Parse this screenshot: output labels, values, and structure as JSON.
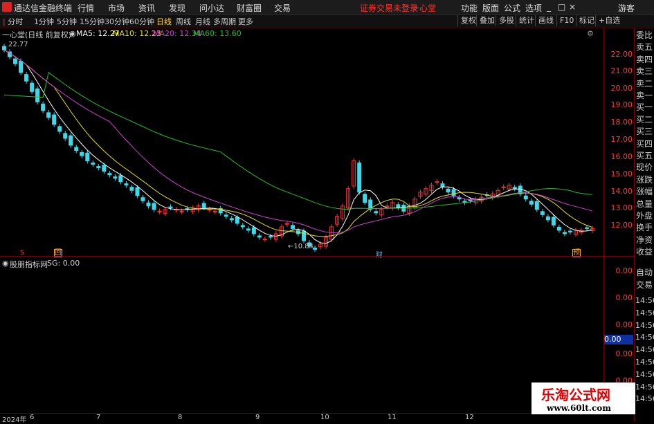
{
  "app": {
    "title": "通达信金融终端"
  },
  "menu": [
    "行情",
    "市场",
    "资讯",
    "发现",
    "问小达",
    "财富圈",
    "交易"
  ],
  "status": {
    "warning": "证券交易未登录",
    "stock_name": "一心堂"
  },
  "right_menu": [
    "功能",
    "版面",
    "公式",
    "选项"
  ],
  "user": "游客",
  "periods": [
    "分时",
    "1分钟",
    "5分钟",
    "15分钟",
    "30分钟",
    "60分钟",
    "日线",
    "周线",
    "月线",
    "多周期",
    "更多"
  ],
  "active_period": "日线",
  "tools": [
    "复权",
    "叠加",
    "多股",
    "统计",
    "画线",
    "F10",
    "标记",
    "+自选"
  ],
  "main_legend": {
    "title": "一心堂(日线 前复权)",
    "ma5": "MA5: 12.27",
    "ma10": "MA10: 12.23",
    "ma20": "MA20: 12.34",
    "ma60": "MA60: 13.60"
  },
  "colors": {
    "ma5": "#ffffff",
    "ma10": "#e8e000",
    "ma20": "#d040d0",
    "ma60": "#20c020",
    "up": "#ff3030",
    "down": "#40d8e8"
  },
  "y_ticks": [
    "22.00",
    "21.00",
    "20.00",
    "19.00",
    "18.00",
    "17.00",
    "16.00",
    "15.00",
    "14.00",
    "13.00",
    "12.00"
  ],
  "annotations": {
    "high": "22.77",
    "low": "←10.84",
    "cai": "财",
    "yu": "预",
    "s": "S",
    "hui": "回"
  },
  "indicator": {
    "name": "股朋指标网",
    "sg": "SG: 0.00"
  },
  "y2_ticks": [
    "0.00",
    "0.00",
    "0.00",
    "0.00",
    "0.00"
  ],
  "y2_box": "0.00",
  "x_ticks": [
    "2024年",
    "6",
    "7",
    "8",
    "9",
    "10",
    "11",
    "12"
  ],
  "right_panel": [
    "委比",
    "卖五",
    "卖四",
    "卖三",
    "卖二",
    "卖一",
    "买一",
    "买二",
    "买三",
    "买四",
    "买五",
    "现价",
    "涨跌",
    "涨幅",
    "总量",
    "外盘",
    "换手",
    "净资",
    "收益"
  ],
  "right_panel2": [
    "自动",
    "交易"
  ],
  "times": [
    "14:56",
    "14:56",
    "14:56",
    "14:56",
    "14:56",
    "14:56",
    "14:56",
    "14:56",
    "14:56"
  ],
  "watermark": {
    "line1": "乐淘公式网",
    "line2": "www.60lt.com"
  },
  "chart_data": {
    "type": "candlestick",
    "ylim": [
      11.2,
      23.4
    ],
    "close": [
      22.6,
      22.2,
      21.8,
      21.3,
      20.8,
      20.2,
      19.6,
      19.1,
      18.7,
      18.3,
      17.9,
      17.5,
      17.1,
      16.8,
      16.5,
      16.2,
      16.0,
      15.8,
      15.6,
      15.4,
      15.2,
      15.0,
      14.8,
      14.5,
      14.2,
      13.9,
      13.6,
      13.4,
      13.3,
      13.4,
      13.5,
      13.4,
      13.3,
      13.4,
      13.5,
      13.6,
      13.5,
      13.4,
      13.3,
      13.2,
      13.0,
      12.8,
      12.6,
      12.4,
      12.2,
      12.0,
      11.8,
      11.7,
      11.8,
      12.0,
      12.4,
      12.6,
      12.3,
      12.0,
      11.6,
      11.3,
      11.1,
      11.4,
      11.8,
      12.4,
      13.0,
      13.6,
      14.6,
      16.2,
      14.4,
      13.8,
      13.4,
      13.2,
      13.4,
      13.6,
      13.8,
      13.5,
      13.3,
      13.6,
      14.0,
      14.4,
      14.6,
      14.8,
      15.0,
      14.7,
      14.4,
      14.2,
      14.0,
      13.8,
      13.9,
      14.0,
      14.1,
      14.2,
      14.3,
      14.5,
      14.7,
      14.8,
      14.6,
      14.3,
      14.0,
      13.7,
      13.4,
      13.1,
      12.8,
      12.5,
      12.2,
      12.0,
      12.1,
      12.2,
      12.2,
      12.3,
      12.3
    ]
  }
}
